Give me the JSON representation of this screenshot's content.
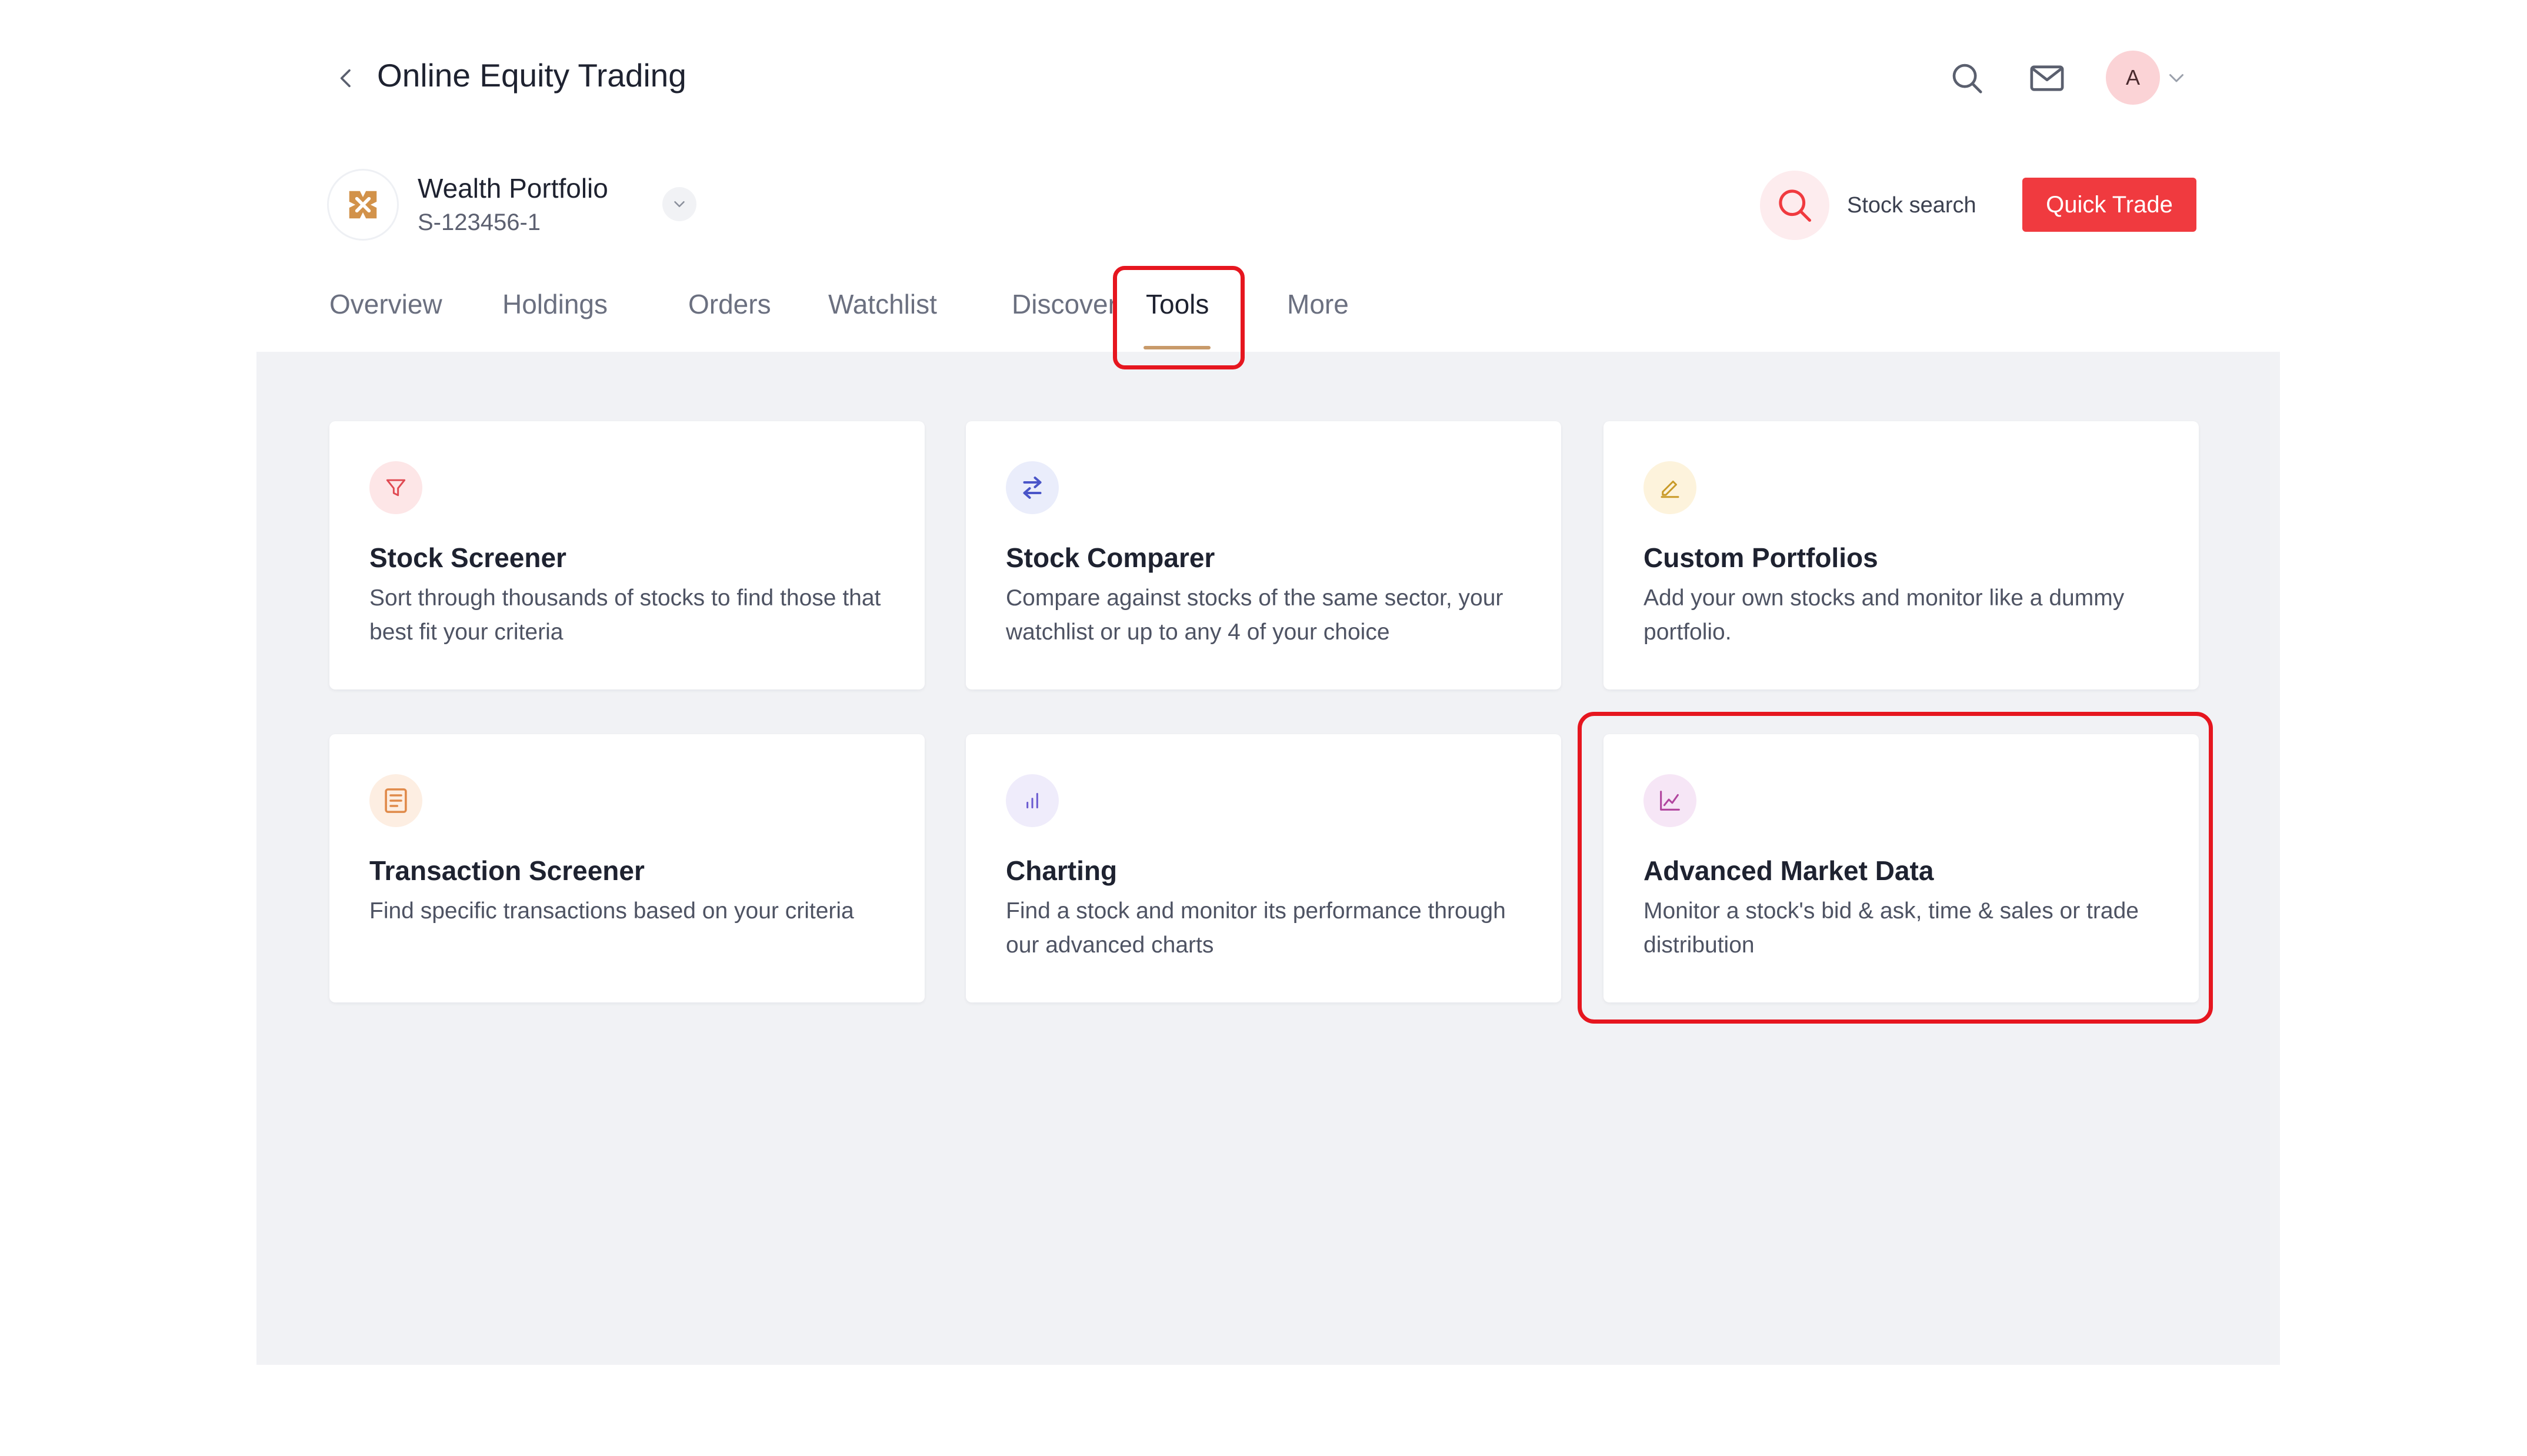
{
  "header": {
    "title": "Online Equity Trading",
    "avatar_initial": "A"
  },
  "portfolio": {
    "name": "Wealth Portfolio",
    "id": "S-123456-1"
  },
  "stock_search_label": "Stock search",
  "quick_trade_label": "Quick Trade",
  "tabs": [
    {
      "label": "Overview"
    },
    {
      "label": "Holdings"
    },
    {
      "label": "Orders"
    },
    {
      "label": "Watchlist"
    },
    {
      "label": "Discover"
    },
    {
      "label": "Tools",
      "active": true
    },
    {
      "label": "More"
    }
  ],
  "cards": [
    {
      "icon": "filter-icon",
      "title": "Stock Screener",
      "description": "Sort through thousands of stocks to find those that best fit your criteria"
    },
    {
      "icon": "compare-arrows-icon",
      "title": "Stock Comparer",
      "description": "Compare against stocks of the same sector, your watchlist or up to any 4 of your choice"
    },
    {
      "icon": "pencil-icon",
      "title": "Custom Portfolios",
      "description": "Add your own stocks and monitor like a dummy portfolio."
    },
    {
      "icon": "document-list-icon",
      "title": "Transaction Screener",
      "description": "Find specific transactions based on your criteria"
    },
    {
      "icon": "bar-chart-icon",
      "title": "Charting",
      "description": "Find a stock and monitor its performance through our advanced charts"
    },
    {
      "icon": "line-chart-icon",
      "title": "Advanced Market Data",
      "description": "Monitor a stock's bid & ask, time & sales or trade distribution"
    }
  ],
  "colors": {
    "brand_red": "#f03a3f",
    "highlight_red": "#e6161f",
    "active_tab_underline": "#c89a6a",
    "content_background": "#f1f2f5"
  }
}
